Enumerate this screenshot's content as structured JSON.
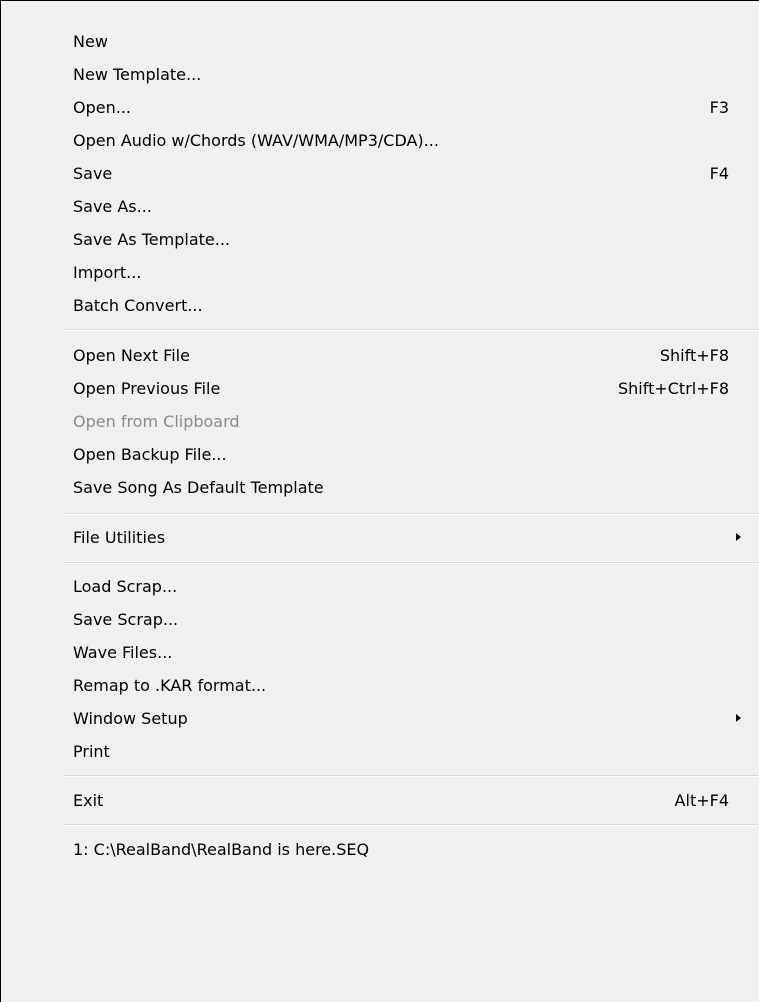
{
  "menu": {
    "items": [
      {
        "label": "New",
        "shortcut": ""
      },
      {
        "label": "New Template...",
        "shortcut": ""
      },
      {
        "label": "Open...",
        "shortcut": "F3"
      },
      {
        "label": "Open Audio w/Chords (WAV/WMA/MP3/CDA)...",
        "shortcut": ""
      },
      {
        "label": "Save",
        "shortcut": "F4"
      },
      {
        "label": "Save As...",
        "shortcut": ""
      },
      {
        "label": "Save As Template...",
        "shortcut": ""
      },
      {
        "label": "Import...",
        "shortcut": ""
      },
      {
        "label": "Batch Convert...",
        "shortcut": ""
      },
      {
        "label": "Open Next File",
        "shortcut": "Shift+F8"
      },
      {
        "label": "Open Previous File",
        "shortcut": "Shift+Ctrl+F8"
      },
      {
        "label": "Open from Clipboard",
        "shortcut": "",
        "disabled": true
      },
      {
        "label": "Open Backup File...",
        "shortcut": ""
      },
      {
        "label": "Save Song As Default Template",
        "shortcut": ""
      },
      {
        "label": "File Utilities",
        "shortcut": "",
        "submenu": true
      },
      {
        "label": "Load Scrap...",
        "shortcut": ""
      },
      {
        "label": "Save Scrap...",
        "shortcut": ""
      },
      {
        "label": "Wave Files...",
        "shortcut": ""
      },
      {
        "label": "Remap to .KAR format...",
        "shortcut": ""
      },
      {
        "label": "Window Setup",
        "shortcut": "",
        "submenu": true
      },
      {
        "label": "Print",
        "shortcut": ""
      },
      {
        "label": "Exit",
        "shortcut": "Alt+F4"
      },
      {
        "label": "1: C:\\RealBand\\RealBand is here.SEQ",
        "shortcut": ""
      }
    ]
  }
}
